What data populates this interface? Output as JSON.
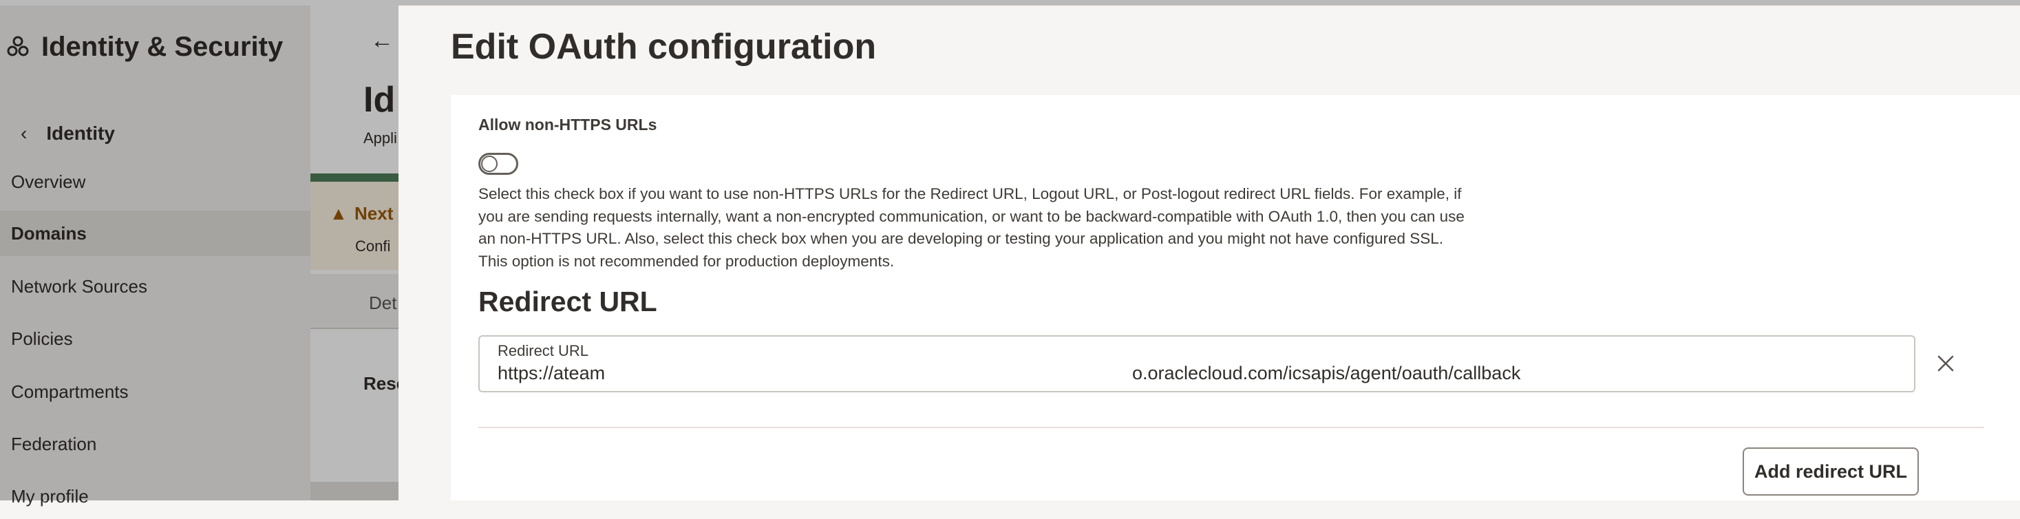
{
  "console": {
    "brand_title": "Identity & Security",
    "back_label": "Identity",
    "nav_items": [
      "Overview",
      "Domains",
      "Network Sources",
      "Policies",
      "Compartments",
      "Federation",
      "My profile"
    ],
    "active_item": "Domains",
    "page_title_fragment": "Id",
    "page_subtitle_fragment": "Appli",
    "banner_title_fragment": "Next",
    "banner_text_fragment": "Confi",
    "tab_fragment": "Det",
    "section_fragment": "Reso"
  },
  "drawer": {
    "title": "Edit OAuth configuration",
    "allow_http": {
      "label": "Allow non-HTTPS URLs",
      "enabled": false,
      "help": "Select this check box if you want to use non-HTTPS URLs for the Redirect URL, Logout URL, or Post-logout redirect URL fields. For example, if you are sending requests internally, want a non-encrypted communication, or want to be backward-compatible with OAuth 1.0, then you can use an non-HTTPS URL. Also, select this check box when you are developing or testing your application and you might not have configured SSL. This option is not recommended for production deployments."
    },
    "redirect": {
      "section_title": "Redirect URL",
      "field_label": "Redirect URL",
      "value_start": "https://ateam",
      "value_end": "o.oraclecloud.com/icsapis/agent/oauth/callback",
      "add_button": "Add redirect URL"
    }
  },
  "icons": {
    "logo": "identity-security-logo-icon",
    "back": "chevron-left-icon",
    "arrow": "arrow-left-icon",
    "warning": "warning-icon",
    "remove": "close-icon"
  },
  "colors": {
    "text": "#312d2a",
    "warning": "#9a5a06",
    "accent_stripe": "#4f7d5a"
  }
}
